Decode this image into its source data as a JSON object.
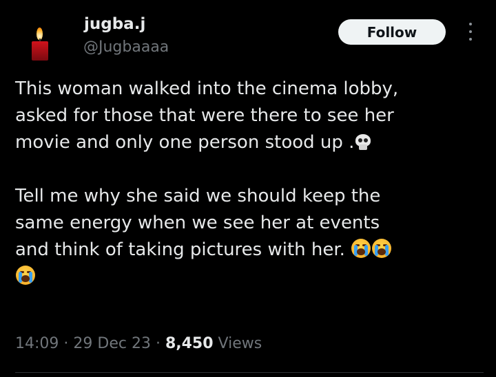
{
  "tweet": {
    "author_name": "jugba.j",
    "author_handle": "@Jugbaaaa",
    "follow_label": "Follow",
    "text_lines_p1": [
      "This woman walked into the cinema lobby,",
      "asked for those that were there to see her",
      "movie and only one person stood up ."
    ],
    "text_lines_p2": [
      "Tell me why she said we should keep the",
      "same energy when we see her at events",
      "and think of taking pictures with her."
    ],
    "emojis": [
      "skull-emoji",
      "loudly-crying-face-emoji",
      "loudly-crying-face-emoji",
      "loudly-crying-face-emoji"
    ],
    "time": "14:09",
    "date": "29 Dec 23",
    "views_count": "8,450",
    "views_label": "Views",
    "separator": "·"
  },
  "colors": {
    "background": "#000000",
    "text": "#e7e9ea",
    "muted": "#71767b",
    "follow_bg": "#eff3f4"
  }
}
